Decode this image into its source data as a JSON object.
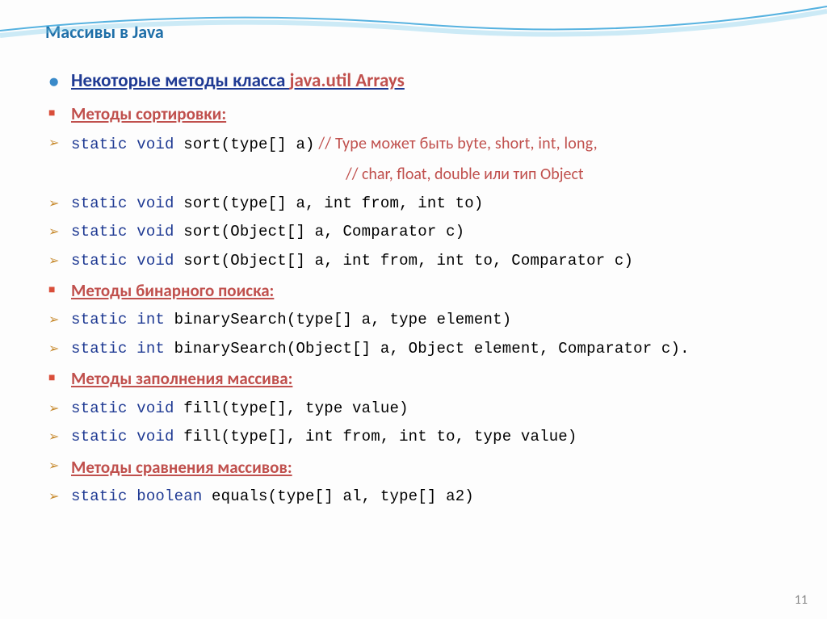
{
  "title": "Массивы в Java",
  "h1_pre": "Некоторые методы класса ",
  "h1_link": "java.util Arrays",
  "sections": {
    "sort_h": "Методы сортировки:",
    "sort1_kw": "static void",
    "sort1_code": " sort(type[] a)",
    "sort1_c1": "  // Type может быть byte, short, int, long,",
    "sort1_c2": "// char, float, double или тип Object",
    "sort2_kw": "static void",
    "sort2_code": " sort(type[] a, int from, int to)",
    "sort3_kw": "static void",
    "sort3_code": " sort(Object[] a, Comparator c)",
    "sort4_kw": "static void",
    "sort4_code": " sort(Object[] a, int from, int to, Comparator c)",
    "bin_h": "Методы бинарного поиска:",
    "bin1_kw": "static int",
    "bin1_code": " binarySearch(type[] a, type element)",
    "bin2_kw": "static int",
    "bin2_code": " binarySearch(Object[] a, Object element, Comparator c).",
    "fill_h": " Методы заполнения массива:",
    "fill1_kw": "static void",
    "fill1_code": " fill(type[], type value)",
    "fill2_kw": "static void",
    "fill2_code": " fill(type[], int from, int to, type value)",
    "eq_h": " Методы сравнения массивов:",
    "eq1_kw": "static boolean",
    "eq1_code": " equals(type[] al, type[] a2)"
  },
  "page": "11"
}
